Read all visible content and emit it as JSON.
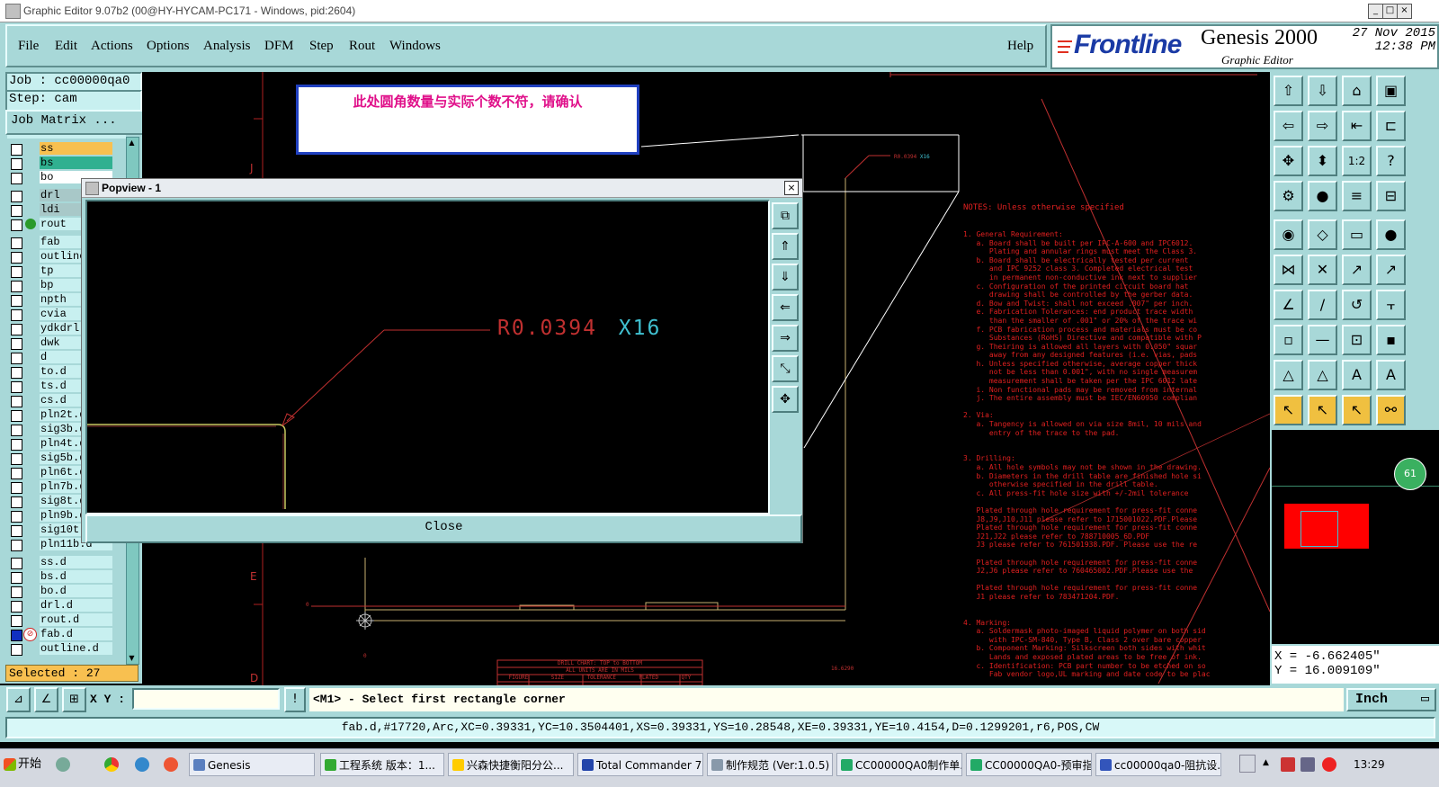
{
  "window": {
    "title": "Graphic Editor 9.07b2 (00@HY-HYCAM-PC171 - Windows, pid:2604)"
  },
  "menu": {
    "items": [
      "File",
      "Edit",
      "Actions",
      "Options",
      "Analysis",
      "DFM",
      "Step",
      "Rout",
      "Windows"
    ],
    "help": "Help"
  },
  "brand": {
    "logo": "Frontline",
    "product": "Genesis 2000",
    "subtitle": "Graphic Editor",
    "date": "27 Nov 2015",
    "time": "12:38 PM"
  },
  "job": {
    "name": "Job : cc00000qa0",
    "step": "Step: cam",
    "matrix_button": "Job Matrix ..."
  },
  "layers": [
    {
      "name": "ss",
      "color": "#f8c050"
    },
    {
      "name": "bs",
      "color": "#30b090"
    },
    {
      "name": "bo",
      "color": "#ffffff"
    },
    {
      "name": "drl",
      "color": "#a8c8c8"
    },
    {
      "name": "ldi",
      "color": "#a8c8c8"
    },
    {
      "name": "rout",
      "color": "#c8f0f0",
      "marker": "green"
    },
    {
      "name": "fab",
      "color": "#c8f0f0"
    },
    {
      "name": "outline",
      "color": "#c8f0f0"
    },
    {
      "name": "tp",
      "color": "#c8f0f0"
    },
    {
      "name": "bp",
      "color": "#c8f0f0"
    },
    {
      "name": "npth",
      "color": "#c8f0f0"
    },
    {
      "name": "cvia",
      "color": "#c8f0f0"
    },
    {
      "name": "ydkdrl",
      "color": "#c8f0f0"
    },
    {
      "name": "dwk",
      "color": "#c8f0f0"
    },
    {
      "name": "d",
      "color": "#c8f0f0"
    },
    {
      "name": "to.d",
      "color": "#c8f0f0"
    },
    {
      "name": "ts.d",
      "color": "#c8f0f0"
    },
    {
      "name": "cs.d",
      "color": "#c8f0f0"
    },
    {
      "name": "pln2t.d",
      "color": "#c8f0f0"
    },
    {
      "name": "sig3b.d",
      "color": "#c8f0f0"
    },
    {
      "name": "pln4t.d",
      "color": "#c8f0f0"
    },
    {
      "name": "sig5b.d",
      "color": "#c8f0f0"
    },
    {
      "name": "pln6t.d",
      "color": "#c8f0f0"
    },
    {
      "name": "pln7b.d",
      "color": "#c8f0f0"
    },
    {
      "name": "sig8t.d",
      "color": "#c8f0f0"
    },
    {
      "name": "pln9b.d",
      "color": "#c8f0f0"
    },
    {
      "name": "sig10t.d",
      "color": "#c8f0f0"
    },
    {
      "name": "pln11b.d",
      "color": "#c8f0f0"
    },
    {
      "name": "ss.d",
      "color": "#c8f0f0"
    },
    {
      "name": "bs.d",
      "color": "#c8f0f0"
    },
    {
      "name": "bo.d",
      "color": "#c8f0f0"
    },
    {
      "name": "drl.d",
      "color": "#c8f0f0"
    },
    {
      "name": "rout.d",
      "color": "#c8f0f0"
    },
    {
      "name": "fab.d",
      "color": "#c8f0f0",
      "active": true
    },
    {
      "name": "outline.d",
      "color": "#c8f0f0"
    }
  ],
  "selected": "Selected : 27",
  "callout": "此处圆角数量与实际个数不符，请确认",
  "popview": {
    "title": "Popview - 1",
    "annotation": "R0.0394",
    "count": "X16",
    "close_label": "Close"
  },
  "canvas": {
    "small_label": "R0.0394 X16",
    "notes_title": "NOTES: Unless otherwise specified",
    "notes": [
      "1. General Requirement:",
      "   a. Board shall be built per IPC-A-600 and IPC6012.",
      "      Plating and annular rings must meet the Class 3.",
      "   b. Board shall be electrically tested per current",
      "      and IPC 9252 class 3. Completed electrical test",
      "      in permanent non-conductive ink next to supplier",
      "   c. Configuration of the printed circuit board hat",
      "      drawing shall be controlled by the gerber data.",
      "   d. Bow and Twist: shall not exceed .007\" per inch.",
      "   e. Fabrication Tolerances: end product trace width",
      "      than the smaller of .001\" or 20% of the trace wi",
      "   f. PCB fabrication process and materials must be co",
      "      Substances (RoHS) Directive and compatible with P",
      "   g. Theiring is allowed all layers with 0.050\" squar",
      "      away from any designed features (i.e. vias, pads",
      "   h. Unless specified otherwise, average copper thick",
      "      not be less than 0.001\", with no single measurem",
      "      measurement shall be taken per the IPC 6012 late",
      "   i. Non functional pads may be removed from internal",
      "   j. The entire assembly must be IEC/EN60950 complian",
      "",
      "2. Via:",
      "   a. Tangency is allowed on via size 8mil, 10 mils and",
      "      entry of the trace to the pad.",
      "",
      "",
      "3. Drilling:",
      "   a. All hole symbols may not be shown in the drawing.",
      "   b. Diameters in the drill table are finished hole si",
      "      otherwise specified in the drill table.",
      "   c. All press-fit hole size with +/-2mil tolerance",
      "",
      "   Plated through hole requirement for press-fit conne",
      "   J8,J9,J10,J11 please refer to 1715001022.PDF.Please",
      "   Plated through hole requirement for press-fit conne",
      "   J21,J22 please refer to 788710005_6D.PDF",
      "   J3 please refer to 761501938.PDF. Please use the re",
      "",
      "   Plated through hole requirement for press-fit conne",
      "   J2,J6 please refer to 760465002.PDF.Please use the",
      "",
      "   Plated through hole requirement for press-fit conne",
      "   J1 please refer to 783471204.PDF.",
      "",
      "",
      "4. Marking:",
      "   a. Soldermask photo-imaged liquid polymer on both sid",
      "      with IPC-SM-840, Type B, Class 2 over bare copper",
      "   b. Component Marking: Silkscreen both sides with whit",
      "      Lands and exposed plated areas to be free of ink.",
      "   c. Identification: PCB part number to be etched on so",
      "      Fab vendor logo,UL marking and date code to be plac"
    ],
    "drill_chart_title": "DRILL CHART: TOP to BOTTOM",
    "drill_chart_sub": "ALL UNITS ARE IN MILS",
    "drill_cols": [
      "FIGURE",
      "SIZE",
      "TOLERANCE",
      "PLATED",
      "QTY"
    ],
    "ruler_letters": [
      "J",
      "E",
      "D"
    ],
    "coord_label": "16.6290",
    "ruler_mark": "0"
  },
  "coords": {
    "x": "X = -6.662405\"",
    "y": "Y = 16.009109\""
  },
  "minimap_badge": "61",
  "command": {
    "xy_label": "X Y :",
    "xy_value": "",
    "prompt": "<M1> - Select first rectangle corner",
    "units": "Inch"
  },
  "status": "fab.d,#17720,Arc,XC=0.39331,YC=10.3504401,XS=0.39331,YS=10.28548,XE=0.39331,YE=10.4154,D=0.1299201,r6,POS,CW",
  "taskbar": {
    "start": "开始",
    "items": [
      "Genesis",
      "工程系统  版本：1...",
      "兴森快捷衡阳分公...",
      "Total Commander 7.0...",
      "制作规范 (Ver:1.0.5)",
      "CC00000QA0制作单...",
      "CC00000QA0-预审指...",
      "cc00000qa0-阻抗设..."
    ],
    "clock": "13:29"
  }
}
